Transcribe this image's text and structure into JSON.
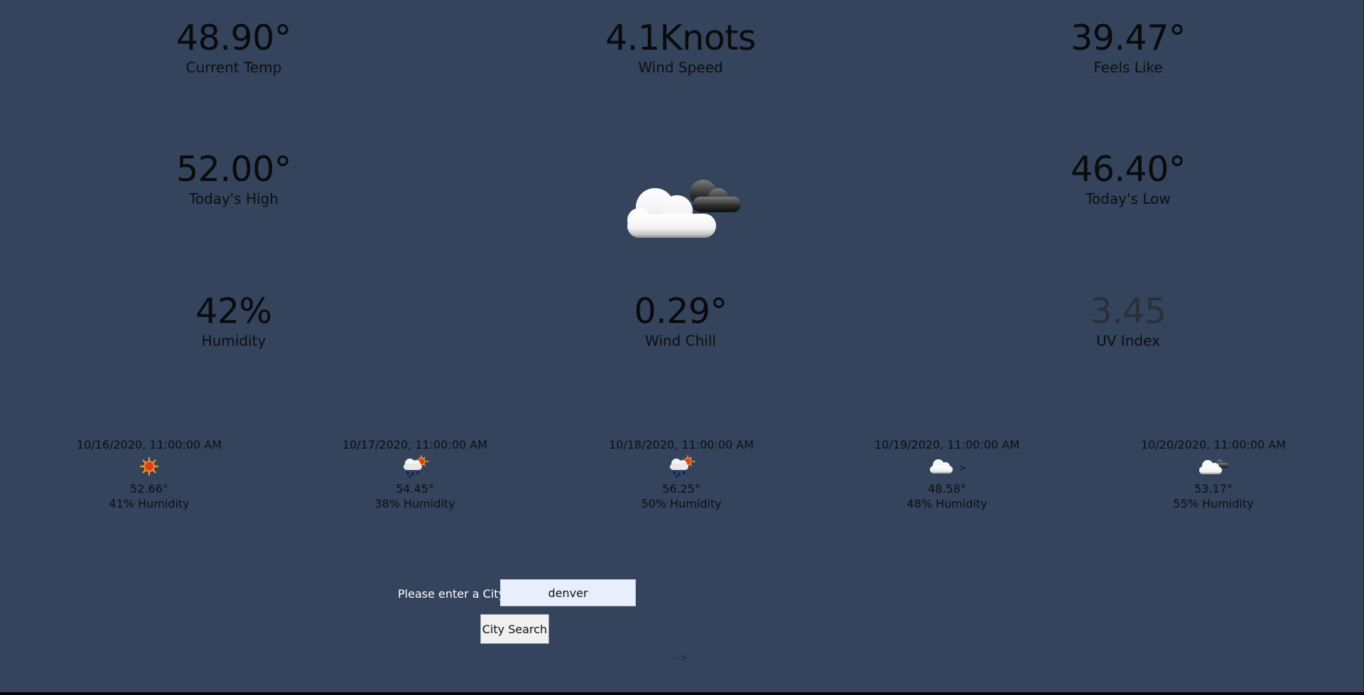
{
  "current": {
    "current_temp": {
      "value": "48.90°",
      "label": "Current Temp"
    },
    "wind_speed": {
      "value": "4.1Knots",
      "label": "Wind Speed"
    },
    "feels_like": {
      "value": "39.47°",
      "label": "Feels Like"
    },
    "todays_high": {
      "value": "52.00°",
      "label": "Today's High"
    },
    "todays_low": {
      "value": "46.40°",
      "label": "Today's Low"
    },
    "humidity": {
      "value": "42%",
      "label": "Humidity"
    },
    "wind_chill": {
      "value": "0.29°",
      "label": "Wind Chill"
    },
    "uv_index": {
      "value": "3.45",
      "label": "UV Index"
    },
    "icon": "partly-cloudy-night-icon"
  },
  "forecast": [
    {
      "date": "10/16/2020, 11:00:00 AM",
      "icon": "sun-icon",
      "temp": "52.66°",
      "humidity": "41% Humidity"
    },
    {
      "date": "10/17/2020, 11:00:00 AM",
      "icon": "sun-rain-cloud-icon",
      "temp": "54.45°",
      "humidity": "38% Humidity"
    },
    {
      "date": "10/18/2020, 11:00:00 AM",
      "icon": "sun-rain-cloud-icon",
      "temp": "56.25°",
      "humidity": "50% Humidity"
    },
    {
      "date": "10/19/2020, 11:00:00 AM",
      "icon": "cloud-icon",
      "icon_alt": ">",
      "temp": "48.58°",
      "humidity": "48% Humidity"
    },
    {
      "date": "10/20/2020, 11:00:00 AM",
      "icon": "cloud-night-icon",
      "temp": "53.17°",
      "humidity": "55% Humidity"
    }
  ],
  "search": {
    "label": "Please enter a City",
    "value": "denver",
    "button_label": "City Search"
  },
  "footer_text": "-->",
  "colors": {
    "background": "#34445d",
    "input_background": "#e8eefc",
    "button_background": "#f0f0f0"
  }
}
